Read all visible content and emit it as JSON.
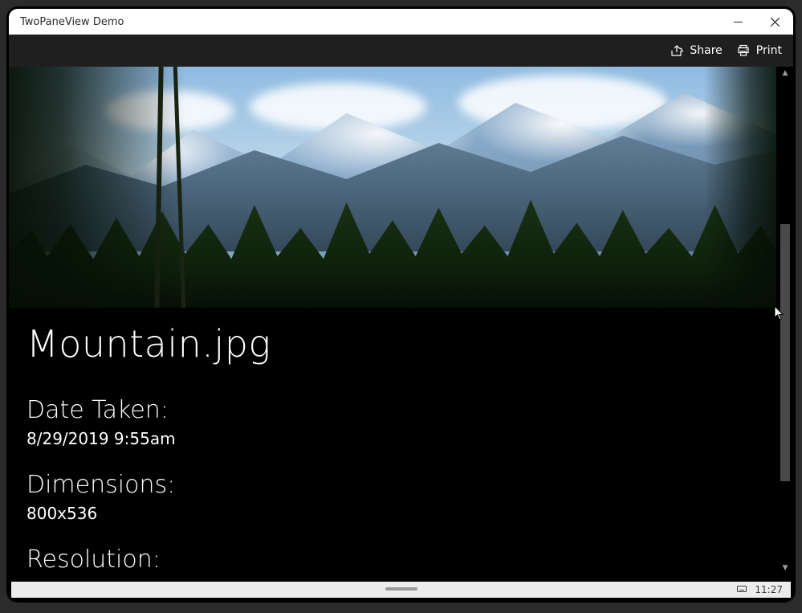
{
  "window": {
    "title": "TwoPaneView Demo"
  },
  "commands": {
    "share_label": "Share",
    "print_label": "Print"
  },
  "details": {
    "file_name": "Mountain.jpg",
    "date_taken_label": "Date Taken:",
    "date_taken_value": "8/29/2019 9:55am",
    "dimensions_label": "Dimensions:",
    "dimensions_value": "800x536",
    "resolution_label": "Resolution:"
  },
  "footer": {
    "time": "11:27"
  }
}
